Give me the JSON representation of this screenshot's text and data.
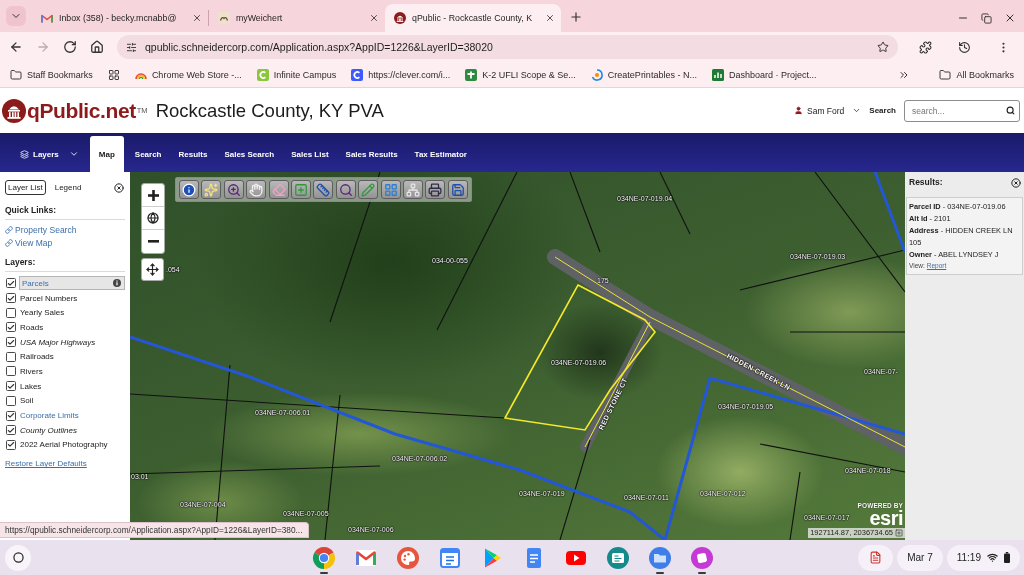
{
  "browser": {
    "tabs": [
      {
        "kind": "mail",
        "title": "Inbox (358) - becky.mcnabb@",
        "selected": false
      },
      {
        "kind": "tile",
        "title": "myWeichert",
        "selected": false
      },
      {
        "kind": "emblem",
        "title": "qPublic - Rockcastle County, K",
        "selected": true
      }
    ],
    "nav_buttons": [
      {
        "kind": "back",
        "disabled": false
      },
      {
        "kind": "forward",
        "disabled": true
      },
      {
        "kind": "reload",
        "disabled": false
      },
      {
        "kind": "home",
        "disabled": false
      }
    ],
    "url": "qpublic.schneidercorp.com/Application.aspx?AppID=1226&LayerID=38020",
    "bookmarks": [
      {
        "kind": "folder",
        "label": "Staff Bookmarks"
      },
      {
        "kind": "apps"
      },
      {
        "kind": "rainbow",
        "label": "Chrome Web Store -..."
      },
      {
        "kind": "campus",
        "label": "Infinite Campus"
      },
      {
        "kind": "letter",
        "label": "https://clever.com/i..."
      },
      {
        "kind": "cross",
        "label": "K-2 UFLI Scope & Se..."
      },
      {
        "kind": "swirl",
        "label": "CreatePrintables - N..."
      },
      {
        "kind": "sheet",
        "label": "Dashboard · Project..."
      }
    ],
    "all_bookmarks": "All Bookmarks"
  },
  "site": {
    "logo": "qPublic.net",
    "trademark": "TM",
    "title": "Rockcastle County, KY PVA",
    "user": "Sam Ford",
    "search_label": "Search",
    "search_placeholder": "search..."
  },
  "nav": [
    {
      "kind": "menu",
      "label": "Layers",
      "selected": false
    },
    {
      "kind": "link",
      "label": "Map",
      "selected": true
    },
    {
      "kind": "link",
      "label": "Search",
      "selected": false
    },
    {
      "kind": "link",
      "label": "Results",
      "selected": false
    },
    {
      "kind": "link",
      "label": "Sales Search",
      "selected": false
    },
    {
      "kind": "link",
      "label": "Sales List",
      "selected": false
    },
    {
      "kind": "link",
      "label": "Sales Results",
      "selected": false
    },
    {
      "kind": "link",
      "label": "Tax Estimator",
      "selected": false
    }
  ],
  "side_panel": {
    "tabs": [
      {
        "label": "Layer List",
        "selected": true
      },
      {
        "label": "Legend",
        "selected": false
      }
    ],
    "quick_links_heading": "Quick Links:",
    "quick_links": [
      "Property Search",
      "View Map"
    ],
    "layers_heading": "Layers:",
    "layers": [
      {
        "label": "Parcels",
        "kind": "link",
        "checked": true,
        "selected": true
      },
      {
        "label": "Parcel Numbers",
        "kind": "plain",
        "checked": true,
        "selected": false
      },
      {
        "label": "Yearly Sales",
        "kind": "plain",
        "checked": false,
        "selected": false
      },
      {
        "label": "Roads",
        "kind": "plain",
        "checked": true,
        "selected": false
      },
      {
        "label": "USA Major Highways",
        "kind": "italic",
        "checked": true,
        "selected": false
      },
      {
        "label": "Railroads",
        "kind": "plain",
        "checked": false,
        "selected": false
      },
      {
        "label": "Rivers",
        "kind": "plain",
        "checked": false,
        "selected": false
      },
      {
        "label": "Lakes",
        "kind": "plain",
        "checked": true,
        "selected": false
      },
      {
        "label": "Soil",
        "kind": "plain",
        "checked": false,
        "selected": false
      },
      {
        "label": "Corporate Limits",
        "kind": "link",
        "checked": true,
        "selected": false
      },
      {
        "label": "County Outlines",
        "kind": "italic",
        "checked": true,
        "selected": false
      },
      {
        "label": "2022 Aerial Photography",
        "kind": "plain",
        "checked": true,
        "selected": false
      }
    ],
    "restore_link": "Restore Layer Defaults"
  },
  "map": {
    "labels": [
      {
        "kind": "parcel",
        "text": "034NE-07-019.04"
      },
      {
        "kind": "parcel",
        "text": "034NE-07-019.03"
      },
      {
        "kind": "parcel",
        "text": "034-00-055"
      },
      {
        "kind": "parcel",
        "text": ".054"
      },
      {
        "kind": "parcel",
        "text": "175"
      },
      {
        "kind": "parcel",
        "text": "034NE-07-019.06"
      },
      {
        "kind": "road",
        "text": "RED STONE CT"
      },
      {
        "kind": "road",
        "text": "HIDDEN CREEK LN"
      },
      {
        "kind": "parcel",
        "text": "034NE-07-"
      },
      {
        "kind": "parcel",
        "text": "034NE-07-019.05"
      },
      {
        "kind": "parcel",
        "text": "034NE-07-006.01"
      },
      {
        "kind": "parcel",
        "text": "034NE-07-006.02"
      },
      {
        "kind": "parcel",
        "text": "034NE-07-018"
      },
      {
        "kind": "parcel",
        "text": "03.01"
      },
      {
        "kind": "parcel",
        "text": "034NE-07-019"
      },
      {
        "kind": "parcel",
        "text": "034NE-07-012"
      },
      {
        "kind": "parcel",
        "text": "034NE-07-011"
      },
      {
        "kind": "parcel",
        "text": "034NE-07-004"
      },
      {
        "kind": "parcel",
        "text": "034NE-07-017"
      },
      {
        "kind": "parcel",
        "text": "034NE-07-005"
      },
      {
        "kind": "parcel",
        "text": "034NE-07-006"
      }
    ],
    "attribution_prefix": "POWERED BY",
    "attribution_brand": "esri",
    "coordinates": "1927114.87, 2036734.65"
  },
  "results": {
    "heading": "Results:",
    "fields": [
      "**Parcel ID** - 034NE-07-019.06",
      "**Alt Id** - 2101",
      "**Address** - HIDDEN CREEK LN 105",
      "**Owner** - ABEL LYNDSEY J"
    ],
    "view_label": "View:",
    "view_link": "Report"
  },
  "status_url": "https://qpublic.schneidercorp.com/Application.aspx?AppID=1226&LayerID=380...",
  "taskbar": {
    "apps": [
      {
        "kind": "browser",
        "running": true
      },
      {
        "kind": "mail",
        "running": false
      },
      {
        "kind": "palette",
        "running": false
      },
      {
        "kind": "calendar",
        "running": false
      },
      {
        "kind": "store",
        "running": false
      },
      {
        "kind": "docs",
        "running": false
      },
      {
        "kind": "video",
        "running": false
      },
      {
        "kind": "card",
        "running": false
      },
      {
        "kind": "files",
        "running": true
      },
      {
        "kind": "sticker",
        "running": true
      }
    ],
    "date": "Mar 7",
    "time": "11:19"
  }
}
